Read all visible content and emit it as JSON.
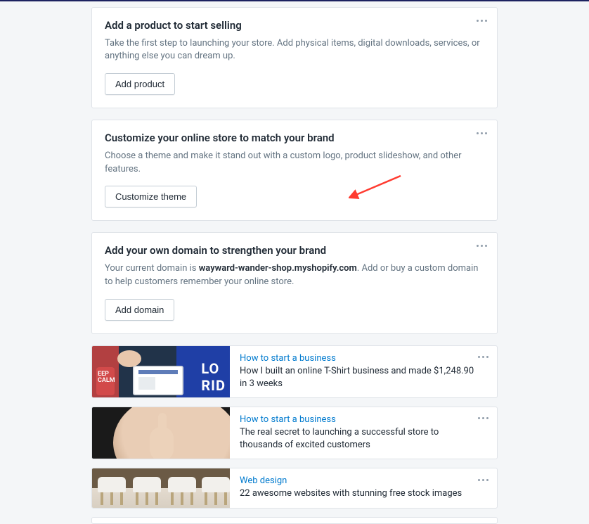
{
  "cards": [
    {
      "title": "Add a product to start selling",
      "desc": "Take the first step to launching your store. Add physical items, digital downloads, services, or anything else you can dream up.",
      "button": "Add product"
    },
    {
      "title": "Customize your online store to match your brand",
      "desc": "Choose a theme and make it stand out with a custom logo, product slideshow, and other features.",
      "button": "Customize theme"
    },
    {
      "title": "Add your own domain to strengthen your brand",
      "desc_pre": "Your current domain is ",
      "domain": "wayward-wander-shop.myshopify.com",
      "desc_post": ". Add or buy a custom domain to help customers remember your online store.",
      "button": "Add domain"
    }
  ],
  "articles": [
    {
      "category": "How to start a business",
      "headline": "How I built an online T-Shirt business and made $1,248.90 in 3 weeks"
    },
    {
      "category": "How to start a business",
      "headline": "The real secret to launching a successful store to thousands of excited customers"
    },
    {
      "category": "Web design",
      "headline": "22 awesome websites with stunning free stock images"
    }
  ],
  "thumb1_right_text": "LO\nRID"
}
